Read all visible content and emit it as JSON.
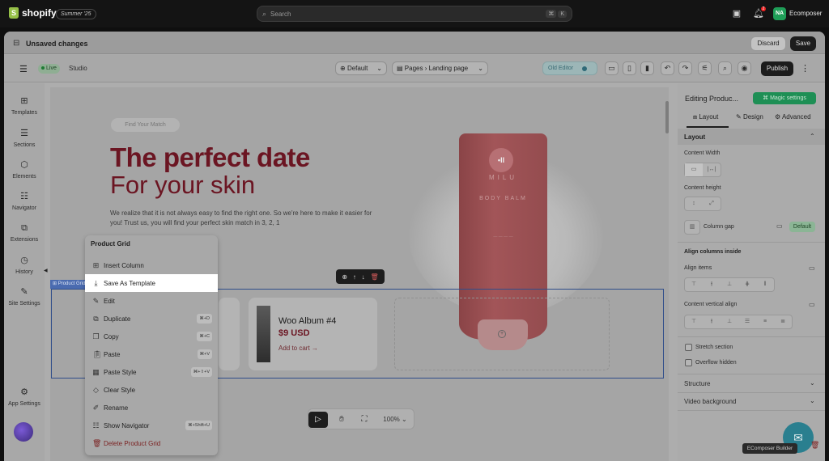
{
  "topbar": {
    "brand": "shopify",
    "edition": "Summer '25",
    "search_placeholder": "Search",
    "search_kbd_1": "⌘",
    "search_kbd_2": "K",
    "notif_count": "2",
    "avatar_initials": "NA",
    "store_name": "Ecomposer"
  },
  "savebar": {
    "status": "Unsaved changes",
    "discard_label": "Discard",
    "save_label": "Save"
  },
  "toolbar": {
    "live_label": "Live",
    "studio_label": "Studio",
    "theme_select": "Default",
    "page_type": "Pages",
    "page_name": "Landing page",
    "old_editor_label": "Old Editor",
    "publish_label": "Publish"
  },
  "leftnav": {
    "items": [
      {
        "label": "Templates",
        "icon": "templates-icon"
      },
      {
        "label": "Sections",
        "icon": "sections-icon"
      },
      {
        "label": "Elements",
        "icon": "elements-icon"
      },
      {
        "label": "Navigator",
        "icon": "navigator-icon"
      },
      {
        "label": "Extensions",
        "icon": "extensions-icon"
      },
      {
        "label": "History",
        "icon": "history-icon"
      },
      {
        "label": "Site Settings",
        "icon": "site-settings-icon"
      }
    ],
    "app_settings": "App Settings"
  },
  "canvas": {
    "hero_tag": "Find Your Match",
    "hero_title_1": "The perfect date",
    "hero_title_2": "For your skin",
    "hero_paragraph": "We realize that it is not always easy to find the right one. So we're here to make it easier for you! Trust us, you will find your perfect skin match in 3, 2, 1",
    "product_brand": "MILU",
    "product_logo": "•II",
    "product_name": "BODY BALM",
    "selection_tag": "Product Grid",
    "product_card": {
      "title": "Woo Album #4",
      "price": "$9 USD",
      "cta": "Add to cart →"
    },
    "zoom": "100%"
  },
  "context_menu": {
    "title": "Product Grid",
    "items": [
      {
        "label": "Insert Column",
        "icon": "insert-column-icon",
        "shortcut": ""
      },
      {
        "label": "Save As Template",
        "icon": "save-template-icon",
        "shortcut": ""
      },
      {
        "label": "Edit",
        "icon": "edit-icon",
        "shortcut": ""
      },
      {
        "label": "Duplicate",
        "icon": "duplicate-icon",
        "shortcut": "⌘+D"
      },
      {
        "label": "Copy",
        "icon": "copy-icon",
        "shortcut": "⌘+C"
      },
      {
        "label": "Paste",
        "icon": "paste-icon",
        "shortcut": "⌘+V"
      },
      {
        "label": "Paste Style",
        "icon": "paste-style-icon",
        "shortcut": "⌘+⇧+V"
      },
      {
        "label": "Clear Style",
        "icon": "clear-style-icon",
        "shortcut": ""
      },
      {
        "label": "Rename",
        "icon": "rename-icon",
        "shortcut": ""
      },
      {
        "label": "Show Navigator",
        "icon": "navigator-icon",
        "shortcut": "⌘+Shift+U"
      },
      {
        "label": "Delete Product Grid",
        "icon": "trash-icon",
        "shortcut": ""
      }
    ],
    "highlighted": "Save As Template"
  },
  "right_panel": {
    "title": "Editing Produc...",
    "magic_label": "Magic settings",
    "tabs": [
      "Layout",
      "Design",
      "Advanced"
    ],
    "active_tab": "Layout",
    "layout_section": "Layout",
    "content_width": "Content Width",
    "content_height": "Content height",
    "column_gap": "Column gap",
    "default_badge": "Default",
    "align_columns_inside": "Align columns inside",
    "align_items": "Align items",
    "content_vertical_align": "Content vertical align",
    "stretch_section": "Stretch section",
    "overflow_hidden": "Overflow hidden",
    "structure": "Structure",
    "video_background": "Video background",
    "tooltip": "EComposer Builder"
  },
  "colors": {
    "accent_brand": "#95bf47",
    "hero_title": "#6b1522",
    "magic": "#1e8f55",
    "publish": "#1c1c1c"
  }
}
